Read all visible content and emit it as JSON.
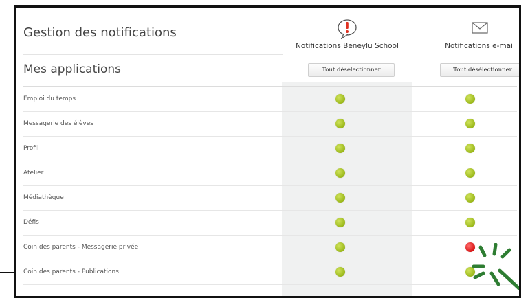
{
  "header": {
    "title": "Gestion des notifications"
  },
  "section": {
    "title": "Mes applications"
  },
  "columns": [
    {
      "label": "Notifications Beneylu School",
      "icon": "alert-bubble-icon",
      "button_label": "Tout désélectionner"
    },
    {
      "label": "Notifications e-mail",
      "icon": "envelope-icon",
      "button_label": "Tout désélectionner"
    }
  ],
  "colors": {
    "on": "#9bb81a",
    "off": "#d81414",
    "alert_icon": "#e03020",
    "burst": "#2e7d32"
  },
  "rows": [
    {
      "label": "Emploi du temps",
      "school": "on",
      "email": "on"
    },
    {
      "label": "Messagerie des élèves",
      "school": "on",
      "email": "on"
    },
    {
      "label": "Profil",
      "school": "on",
      "email": "on"
    },
    {
      "label": "Atelier",
      "school": "on",
      "email": "on"
    },
    {
      "label": "Médiathèque",
      "school": "on",
      "email": "on"
    },
    {
      "label": "Défis",
      "school": "on",
      "email": "on"
    },
    {
      "label": "Coin des parents - Messagerie privée",
      "school": "on",
      "email": "off"
    },
    {
      "label": "Coin des parents - Publications",
      "school": "on",
      "email": "on"
    }
  ]
}
